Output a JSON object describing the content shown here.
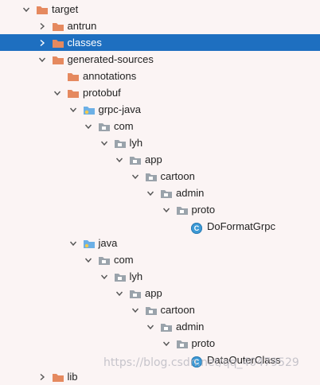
{
  "tree": {
    "items": [
      {
        "label": "target",
        "depth": 0,
        "expanded": true,
        "icon": "folder-orange",
        "selected": false
      },
      {
        "label": "antrun",
        "depth": 1,
        "expanded": false,
        "icon": "folder-orange",
        "selected": false
      },
      {
        "label": "classes",
        "depth": 1,
        "expanded": false,
        "icon": "folder-orange",
        "selected": true
      },
      {
        "label": "generated-sources",
        "depth": 1,
        "expanded": true,
        "icon": "folder-orange",
        "selected": false
      },
      {
        "label": "annotations",
        "depth": 2,
        "expanded": null,
        "icon": "folder-orange",
        "selected": false
      },
      {
        "label": "protobuf",
        "depth": 2,
        "expanded": true,
        "icon": "folder-orange",
        "selected": false
      },
      {
        "label": "grpc-java",
        "depth": 3,
        "expanded": true,
        "icon": "folder-blue-source",
        "selected": false
      },
      {
        "label": "com",
        "depth": 4,
        "expanded": true,
        "icon": "folder-gray",
        "selected": false
      },
      {
        "label": "lyh",
        "depth": 5,
        "expanded": true,
        "icon": "folder-gray",
        "selected": false
      },
      {
        "label": "app",
        "depth": 6,
        "expanded": true,
        "icon": "folder-gray",
        "selected": false
      },
      {
        "label": "cartoon",
        "depth": 7,
        "expanded": true,
        "icon": "folder-gray",
        "selected": false
      },
      {
        "label": "admin",
        "depth": 8,
        "expanded": true,
        "icon": "folder-gray",
        "selected": false
      },
      {
        "label": "proto",
        "depth": 9,
        "expanded": true,
        "icon": "folder-gray",
        "selected": false
      },
      {
        "label": "DoFormatGrpc",
        "depth": 10,
        "expanded": null,
        "icon": "class-icon",
        "selected": false
      },
      {
        "label": "java",
        "depth": 3,
        "expanded": true,
        "icon": "folder-blue-source",
        "selected": false
      },
      {
        "label": "com",
        "depth": 4,
        "expanded": true,
        "icon": "folder-gray",
        "selected": false
      },
      {
        "label": "lyh",
        "depth": 5,
        "expanded": true,
        "icon": "folder-gray",
        "selected": false
      },
      {
        "label": "app",
        "depth": 6,
        "expanded": true,
        "icon": "folder-gray",
        "selected": false
      },
      {
        "label": "cartoon",
        "depth": 7,
        "expanded": true,
        "icon": "folder-gray",
        "selected": false
      },
      {
        "label": "admin",
        "depth": 8,
        "expanded": true,
        "icon": "folder-gray",
        "selected": false
      },
      {
        "label": "proto",
        "depth": 9,
        "expanded": true,
        "icon": "folder-gray",
        "selected": false
      },
      {
        "label": "DataOuterClass",
        "depth": 10,
        "expanded": null,
        "icon": "class-icon",
        "selected": false
      },
      {
        "label": "lib",
        "depth": 1,
        "expanded": false,
        "icon": "folder-orange",
        "selected": false
      }
    ],
    "class_badge": "C"
  },
  "watermark": "https://blog.csdn.net/qq_40479529",
  "colors": {
    "background": "#fbf4f4",
    "selection": "#1e6fc0",
    "folder_orange": "#e5895f",
    "folder_gray": "#9aa3ab",
    "folder_blue": "#6cb0e6",
    "class_icon": "#3d9ad6"
  }
}
